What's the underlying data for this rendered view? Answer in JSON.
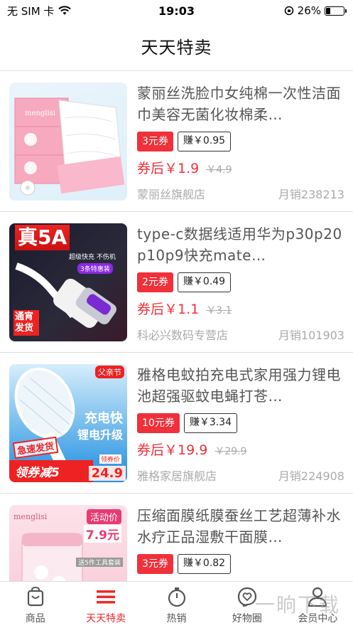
{
  "status": {
    "carrier": "无 SIM 卡",
    "time": "19:03",
    "battery": "26%",
    "battery_level": 0.26
  },
  "header": {
    "title": "天天特卖"
  },
  "products": [
    {
      "title": "蒙丽丝洗脸巾女纯棉一次性洁面巾美容无菌化妆棉柔…",
      "coupon": "3元券",
      "earn": "赚￥0.95",
      "price": "券后￥1.9",
      "original_price": "￥4.9",
      "shop": "蒙丽丝旗舰店",
      "sales": "月销238213",
      "thumb_label": "menglisi"
    },
    {
      "title": "type-c数据线适用华为p30p20p10p9快充mate…",
      "coupon": "2元券",
      "earn": "赚￥0.49",
      "price": "券后￥1.1",
      "original_price": "￥3.1",
      "shop": "科必兴数码专营店",
      "sales": "月销101903",
      "thumb_big": "真5A",
      "thumb_sub": "超级快充 不伤机",
      "thumb_badge": "3条特惠装",
      "thumb_corner": "通宵发货"
    },
    {
      "title": "雅格电蚊拍充电式家用强力锂电池超强驱蚊电蝇打苍…",
      "coupon": "10元券",
      "earn": "赚￥3.34",
      "price": "券后￥19.9",
      "original_price": "￥29.9",
      "shop": "雅格家居旗舰店",
      "sales": "月销224908",
      "thumb_tag": "父亲节",
      "thumb_main": "充电快",
      "thumb_main2": "锂电升级",
      "thumb_stamp": "急速发货",
      "thumb_banner": "领券减5",
      "thumb_price_label": "领券价",
      "thumb_price": "24.9"
    },
    {
      "title": "压缩面膜纸膜蚕丝工艺超薄补水水疗正品湿敷干面膜…",
      "coupon": "3元券",
      "earn": "赚￥0.82",
      "price": "",
      "original_price": "",
      "shop": "",
      "sales": "",
      "thumb_tag": "活动价",
      "thumb_price": "7.9元",
      "thumb_label": "menglisi",
      "thumb_note": "送5件工具套装"
    }
  ],
  "tabs": [
    {
      "label": "商品",
      "icon": "bag-icon",
      "active": false
    },
    {
      "label": "天天特卖",
      "icon": "menu-lines-icon",
      "active": true
    },
    {
      "label": "热销",
      "icon": "stopwatch-icon",
      "active": false
    },
    {
      "label": "好物圈",
      "icon": "heart-chat-icon",
      "active": false
    },
    {
      "label": "会员中心",
      "icon": "person-icon",
      "active": false
    }
  ],
  "watermark": "一晌下载",
  "colors": {
    "accent": "#f0303a",
    "tab_active": "#ec2a2a"
  }
}
